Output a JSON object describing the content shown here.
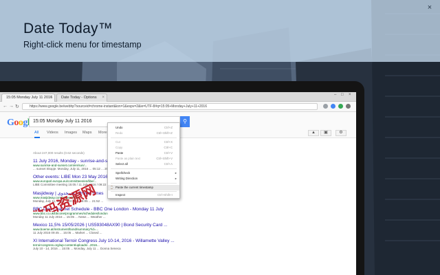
{
  "banner": {
    "title": "Date Today™",
    "subtitle": "Right-click menu for timestamp"
  },
  "browser": {
    "tabs": [
      {
        "label": "15:05 Monday July 11 2016"
      },
      {
        "label": "Date Today - Options"
      }
    ],
    "url": "https://www.google.be/webhp?sourceid=chrome-instant&ion=1&espv=2&ie=UTF-8#q=15:05+Monday+July+11+2016"
  },
  "google": {
    "logo": "Google",
    "query": "15:05 Monday July 11 2016",
    "tabs": [
      "All",
      "Videos",
      "Images",
      "Maps",
      "More"
    ],
    "active_tab": "All"
  },
  "results": {
    "stats": "About 247,000 results (0.62 seconds)",
    "items": [
      {
        "title": "11 July 2016, Monday - sunrise-and-sunset.com",
        "url": "www.sunrise-and-sunset.com/en/sun/...",
        "snippet": "... sunset Skopje. Monday, July 11, 2016 ... 05:12 ... 20:07"
      },
      {
        "title": "Other events: LIBE Mon 23 May 2016 - 15:00",
        "url": "www.europarl.europa.eu/committees/en/libe/...",
        "snippet": "LIBE Committee meeting 15:05 / 11 July 2016 / 09:22 ..."
      },
      {
        "title": "Masjidway | مسجدوی | Prayer times",
        "url": "www.masjidway.com/prayer/2016",
        "snippet": "Monday, July 11, 2016 ... 03:26 ... 15:05 ... 21:52 ..."
      },
      {
        "title": "BBC One Channel Schedule - BBC One London - Monday 11 July",
        "url": "www.bbc.co.uk/bbcone/programmes/schedules/london",
        "snippet": "Monday 11 July 2016 ... 15:05 ... News ... Weather ..."
      },
      {
        "title": "Mexico 11,5% 15/05/2026 | US593048AX90 | Bond Security Card ...",
        "url": "www.boerse.at/instrument/bond/summary?id=...",
        "snippet": "11 July 2016 09:45 ... 15:05 ... Market ... Closed ..."
      },
      {
        "title": "XI International Terroir Congress July 10-14, 2016 - Willamette Valley ...",
        "url": "terroircongress.org/wp-content/uploads/...2016...",
        "snippet": "July 10 - 14, 2016 ... 15:05 ... Monday, July 11 ... Donna Seneca"
      }
    ]
  },
  "context_menu": {
    "items": [
      {
        "label": "Undo",
        "shortcut": "Ctrl+Z",
        "disabled": false
      },
      {
        "label": "Redo",
        "shortcut": "Ctrl+Shift+Z",
        "disabled": true
      },
      {
        "label": "Cut",
        "shortcut": "Ctrl+X",
        "disabled": true
      },
      {
        "label": "Copy",
        "shortcut": "Ctrl+C",
        "disabled": true
      },
      {
        "label": "Paste",
        "shortcut": "Ctrl+V",
        "disabled": false
      },
      {
        "label": "Paste as plain text",
        "shortcut": "Ctrl+Shift+V",
        "disabled": true
      },
      {
        "label": "Select all",
        "shortcut": "Ctrl+A",
        "disabled": false
      },
      {
        "label": "Spellcheck",
        "shortcut": "",
        "disabled": false
      },
      {
        "label": "Writing Direction",
        "shortcut": "",
        "disabled": false
      },
      {
        "label": "Paste the current timestamp",
        "shortcut": "",
        "disabled": false
      },
      {
        "label": "Inspect",
        "shortcut": "Ctrl+Shift+I",
        "disabled": false
      }
    ]
  },
  "watermark": {
    "text": "数码资源网"
  },
  "colors": {
    "banner_bg": "#c6dcf0",
    "google_blue": "#4285f4",
    "link": "#1a0dab",
    "url_green": "#006621",
    "watermark": "#c0101a"
  }
}
